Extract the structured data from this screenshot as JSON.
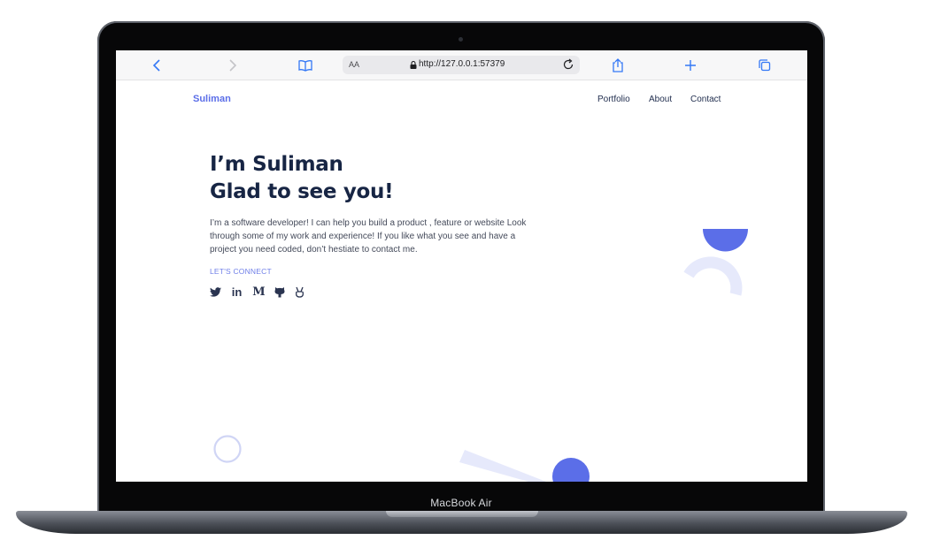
{
  "device": {
    "model_label": "MacBook Air"
  },
  "browser": {
    "url": "http://127.0.0.1:57379",
    "text_size_label": "AA",
    "icons": [
      "back-icon",
      "forward-icon",
      "bookmarks-icon",
      "lock-icon",
      "reload-icon",
      "share-icon",
      "new-tab-icon",
      "tabs-icon"
    ]
  },
  "site": {
    "brand": "Suliman",
    "nav": [
      "Portfolio",
      "About",
      "Contact"
    ],
    "headline_line1": "I’m Suliman",
    "headline_line2": "Glad to see you!",
    "intro": "I’m a software developer! I can help you build a product , feature or website Look through some of my work and experience! If you like what you see and have a project you need coded, don’t hestiate to contact me.",
    "connect_label": "LET'S CONNECT",
    "social_icons": [
      "twitter-icon",
      "linkedin-icon",
      "medium-icon",
      "github-icon",
      "hackerrank-icon"
    ],
    "social_glyphs": {
      "linkedin": "in",
      "medium": "M"
    },
    "colors": {
      "accent": "#5b6ee8",
      "heading": "#172544",
      "decor_light": "#e6e9fb"
    }
  }
}
